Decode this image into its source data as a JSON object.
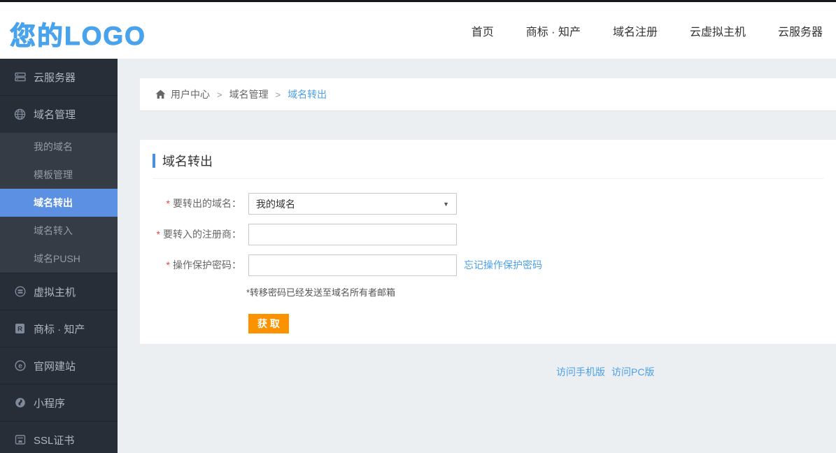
{
  "header": {
    "logo": "您的LOGO",
    "nav": [
      {
        "label": "首页"
      },
      {
        "label": "商标 · 知产"
      },
      {
        "label": "域名注册"
      },
      {
        "label": "云虚拟主机"
      },
      {
        "label": "云服务器"
      }
    ]
  },
  "sidebar": {
    "items": [
      {
        "label": "云服务器",
        "icon": "server-icon"
      },
      {
        "label": "域名管理",
        "icon": "globe-icon",
        "expanded": true,
        "children": [
          {
            "label": "我的域名"
          },
          {
            "label": "模板管理"
          },
          {
            "label": "域名转出",
            "active": true
          },
          {
            "label": "域名转入"
          },
          {
            "label": "域名PUSH"
          }
        ]
      },
      {
        "label": "虚拟主机",
        "icon": "host-icon"
      },
      {
        "label": "商标 · 知产",
        "icon": "trademark-icon"
      },
      {
        "label": "官网建站",
        "icon": "website-icon"
      },
      {
        "label": "小程序",
        "icon": "miniprogram-icon"
      },
      {
        "label": "SSL证书",
        "icon": "certificate-icon"
      }
    ]
  },
  "breadcrumb": {
    "separator": ">",
    "items": [
      {
        "label": "用户中心"
      },
      {
        "label": "域名管理"
      },
      {
        "label": "域名转出",
        "active": true
      }
    ]
  },
  "panel": {
    "title": "域名转出",
    "form": {
      "fields": [
        {
          "required": "*",
          "label": "要转出的域名：",
          "type": "select",
          "value": "我的域名",
          "caret": "▼"
        },
        {
          "required": "*",
          "label": "要转入的注册商：",
          "type": "text",
          "value": ""
        },
        {
          "required": "*",
          "label": "操作保护密码：",
          "type": "text",
          "value": "",
          "link": "忘记操作保护密码"
        }
      ],
      "note": "*转移密码已经发送至域名所有者邮箱",
      "submit_label": "获 取"
    }
  },
  "footer": {
    "links": [
      {
        "label": "访问手机版"
      },
      {
        "label": "访问PC版"
      }
    ]
  },
  "colors": {
    "accent_blue": "#4a9fe8",
    "logo_blue": "#48a2ec",
    "active_item_blue": "#5b90e2",
    "button_orange": "#fb9300",
    "sidebar_bg": "#272e37",
    "submenu_bg": "#353c46",
    "page_bg": "#eceff2",
    "required_red": "#e54545"
  }
}
